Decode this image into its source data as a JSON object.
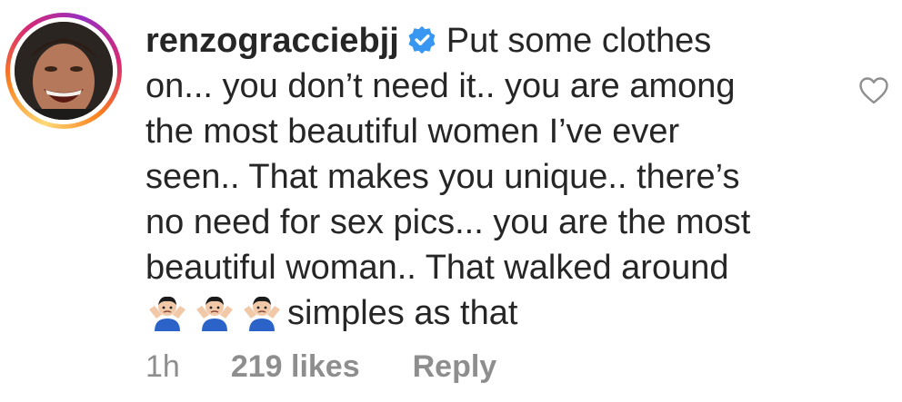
{
  "comment": {
    "username": "renzogracciebjj",
    "verified_icon": "verified-badge-icon",
    "text_lines": [
      "Put some clothes",
      "on... you don’t need it.. you are among",
      "the most beautiful women I’ve ever",
      "seen.. That makes you unique.. there’s",
      "no need for sex pics... you are the most",
      "beautiful woman.. That walked around",
      "simples as that"
    ],
    "emoji": [
      "man-shrugging-icon",
      "man-shrugging-icon",
      "man-shrugging-icon"
    ],
    "time": "1h",
    "likes": "219 likes",
    "reply_label": "Reply",
    "like_icon": "heart-outline-icon"
  },
  "colors": {
    "text": "#262626",
    "meta": "#8e8e8e",
    "verified": "#3897f0"
  }
}
